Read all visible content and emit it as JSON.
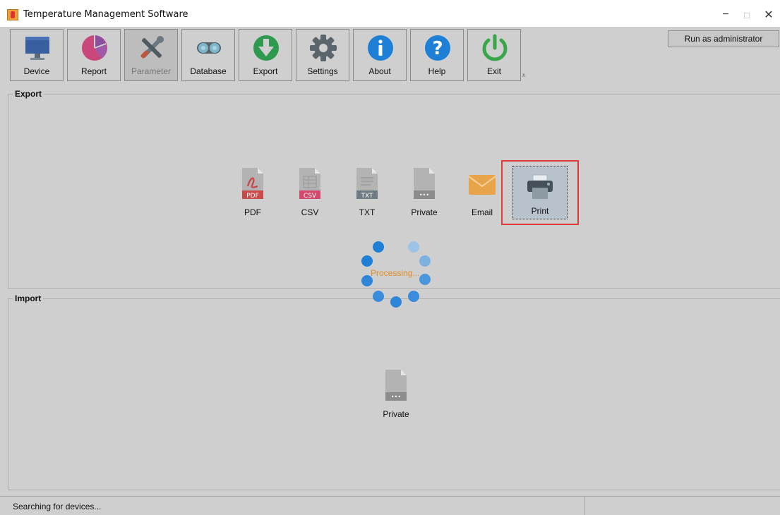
{
  "window": {
    "title": "Temperature Management Software",
    "controls": [
      "−",
      "□",
      "✕"
    ]
  },
  "toolbar": {
    "items": [
      {
        "label": "Device",
        "icon": "monitor-icon"
      },
      {
        "label": "Report",
        "icon": "pie-chart-icon"
      },
      {
        "label": "Parameter",
        "icon": "tools-icon",
        "active": true
      },
      {
        "label": "Database",
        "icon": "binoculars-icon"
      },
      {
        "label": "Export",
        "icon": "download-icon"
      },
      {
        "label": "Settings",
        "icon": "gear-icon"
      },
      {
        "label": "About",
        "icon": "info-icon"
      },
      {
        "label": "Help",
        "icon": "question-icon"
      },
      {
        "label": "Exit",
        "icon": "power-icon"
      }
    ],
    "overflow_glyph": "⩡",
    "run_as_admin": "Run as administrator"
  },
  "export_panel": {
    "title": "Export",
    "items": [
      {
        "label": "PDF",
        "badge": "PDF",
        "color": "#c94a4a"
      },
      {
        "label": "CSV",
        "badge": "CSV",
        "color": "#d24b6e"
      },
      {
        "label": "TXT",
        "badge": "TXT",
        "color": "#6e7b82"
      },
      {
        "label": "Private",
        "badge": "•••",
        "color": "#8c8c8c"
      },
      {
        "label": "Email",
        "badge": "",
        "color": "#e8a449"
      },
      {
        "label": "Print",
        "badge": "",
        "color": "#46505a",
        "selected": true
      }
    ]
  },
  "spinner": {
    "text": "Processing..."
  },
  "import_panel": {
    "title": "Import",
    "items": [
      {
        "label": "Private",
        "badge": "•••",
        "color": "#8c8c8c"
      }
    ]
  },
  "status": {
    "text": "Searching for devices..."
  }
}
